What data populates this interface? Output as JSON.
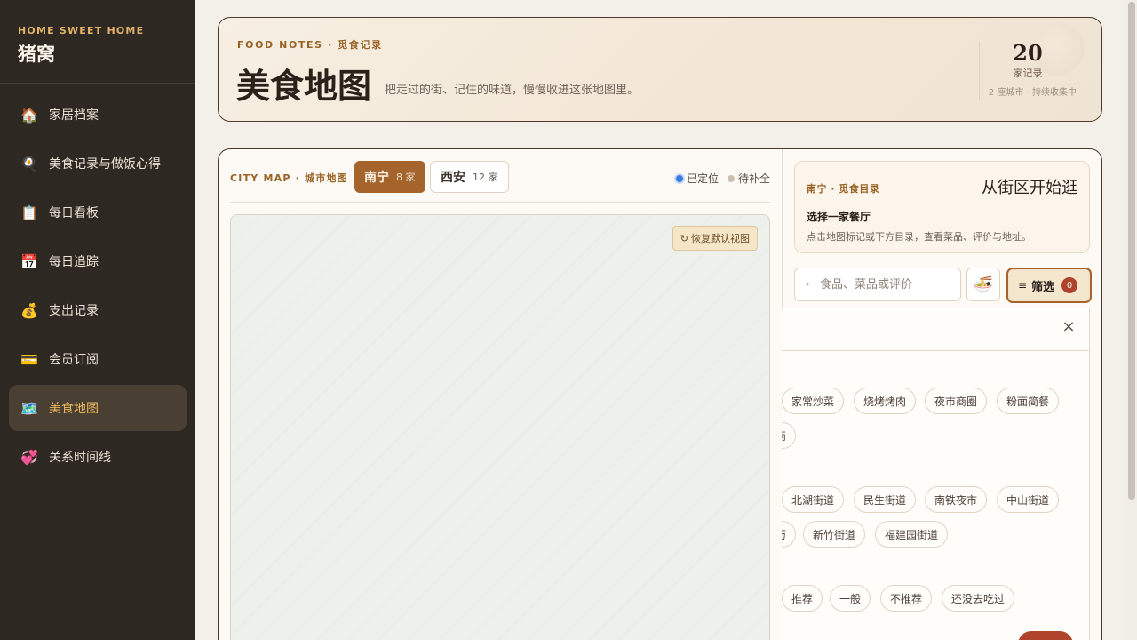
{
  "sidebar": {
    "brand_kicker": "HOME SWEET HOME",
    "brand_title": "猪窝",
    "items": [
      {
        "label": "家居档案",
        "icon": "🏠"
      },
      {
        "label": "美食记录与做饭心得",
        "icon": "🍳"
      },
      {
        "label": "每日看板",
        "icon": "📋"
      },
      {
        "label": "每日追踪",
        "icon": "📅"
      },
      {
        "label": "支出记录",
        "icon": "💰"
      },
      {
        "label": "会员订阅",
        "icon": "💳"
      },
      {
        "label": "美食地图",
        "icon": "🗺️",
        "active": true
      },
      {
        "label": "关系时间线",
        "icon": "💞"
      }
    ]
  },
  "header": {
    "kicker": "FOOD NOTES · 觅食记录",
    "title": "美食地图",
    "subtitle": "把走过的街、记住的味道，慢慢收进这张地图里。",
    "count": "20",
    "count_label": "家记录",
    "note": "2 座城市 · 持续收集中"
  },
  "map": {
    "kicker": "CITY MAP · 城市地图",
    "tabs": [
      {
        "name": "南宁",
        "count": "8 家",
        "active": true
      },
      {
        "name": "西安",
        "count": "12 家",
        "active": false
      }
    ],
    "legend": {
      "located": "已定位",
      "pending": "待补全"
    },
    "reset_label": "恢复默认视图",
    "reset_icon": "↻"
  },
  "info": {
    "kicker": "南宁 · 觅食目录",
    "title": "从街区开始逛",
    "head": "选择一家餐厅",
    "desc": "点击地图标记或下方目录，查看菜品、评价与地址。"
  },
  "search": {
    "placeholder": "食品、菜品或评价",
    "icon": "∘"
  },
  "noodle_icon": "🍜",
  "filter": {
    "label": "筛选",
    "badge": "0",
    "icon": "≡"
  },
  "drawer": {
    "close": "×",
    "cuisine_chips": [
      "家常炒菜",
      "烧烤烤肉",
      "夜市商圈",
      "粉面简餐",
      "丙"
    ],
    "district_chips": [
      "北湖街道",
      "民生街道",
      "南铁夜市",
      "中山街道",
      "历",
      "新竹街道",
      "福建园街道"
    ],
    "rating_chips": [
      "推荐",
      "一般",
      "不推荐",
      "还没去吃过"
    ]
  }
}
